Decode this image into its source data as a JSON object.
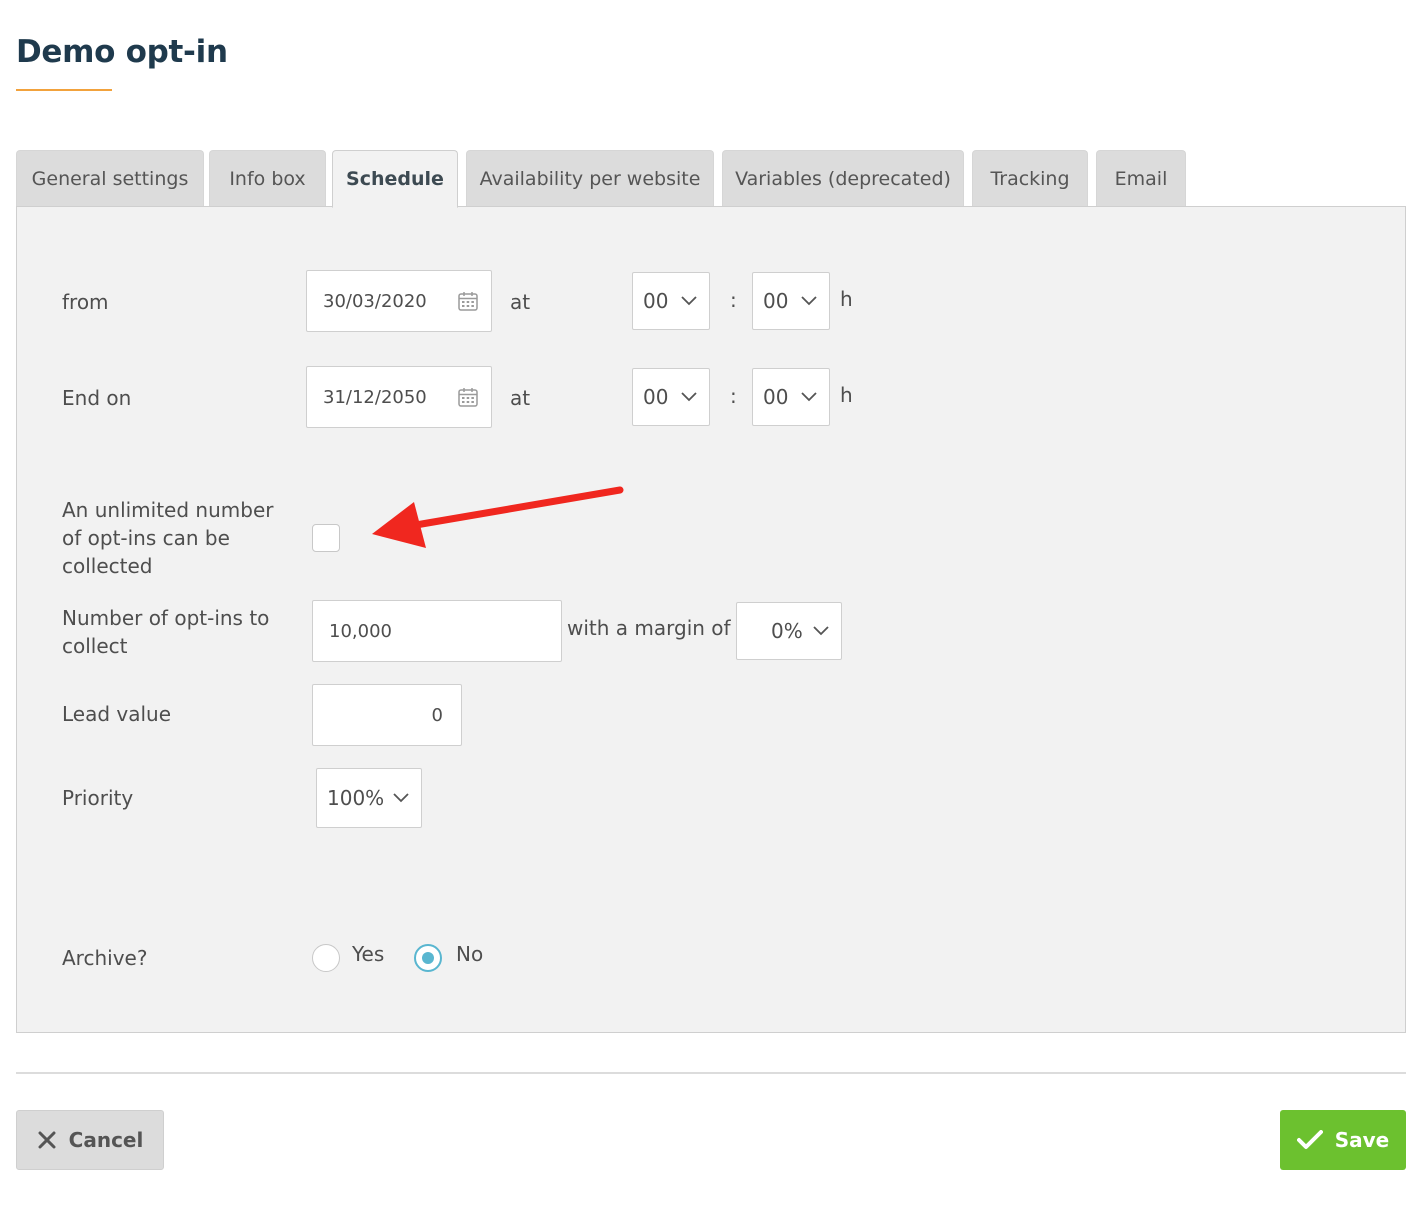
{
  "page": {
    "title": "Demo opt-in"
  },
  "tabs": [
    {
      "label": "General settings"
    },
    {
      "label": "Info box"
    },
    {
      "label": "Schedule",
      "active": true
    },
    {
      "label": "Availability per website"
    },
    {
      "label": "Variables (deprecated)"
    },
    {
      "label": "Tracking"
    },
    {
      "label": "Email"
    }
  ],
  "schedule": {
    "from": {
      "label": "from",
      "date": "30/03/2020",
      "at": "at",
      "hour": "00",
      "sep": ":",
      "minute": "00",
      "unit": "h"
    },
    "end": {
      "label": "End on",
      "date": "31/12/2050",
      "at": "at",
      "hour": "00",
      "sep": ":",
      "minute": "00",
      "unit": "h"
    },
    "unlimited": {
      "label_line1": "An unlimited number",
      "label_line2": "of opt-ins can be",
      "label_line3": "collected",
      "checked": false
    },
    "count": {
      "label_line1": "Number of opt-ins to",
      "label_line2": "collect",
      "value": "10,000",
      "margin_label": "with a margin of",
      "margin_value": "0%"
    },
    "lead": {
      "label": "Lead value",
      "value": "0"
    },
    "priority": {
      "label": "Priority",
      "value": "100%"
    },
    "archive": {
      "label": "Archive?",
      "yes": "Yes",
      "no": "No",
      "selected": "No"
    }
  },
  "actions": {
    "cancel": "Cancel",
    "save": "Save"
  },
  "colors": {
    "accent_underline": "#f2a23c",
    "save_green": "#6cc12f",
    "radio_blue": "#59b6d0",
    "annotation_arrow": "#f0271f"
  }
}
